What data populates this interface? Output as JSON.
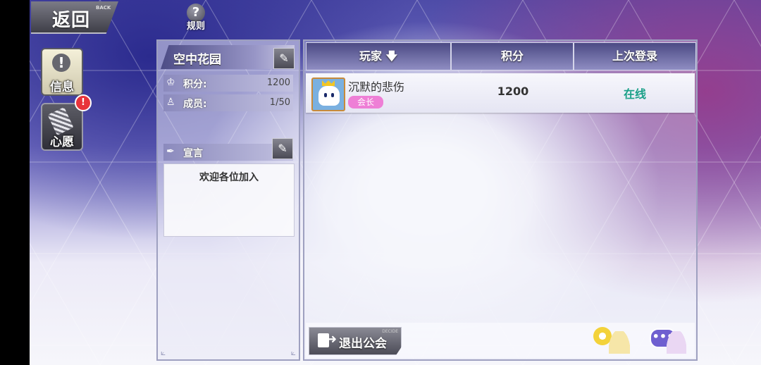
{
  "header": {
    "back_label": "返回",
    "back_sub": "BACK",
    "help_icon": "question-mark-icon",
    "help_label": "规则"
  },
  "sidebar": {
    "items": [
      {
        "label": "信息",
        "icon": "exclamation-icon"
      },
      {
        "label": "心愿",
        "icon": "wish-card-icon",
        "badge": "!"
      }
    ]
  },
  "guild": {
    "name": "空中花园",
    "score_label": "积分:",
    "score_value": "1200",
    "members_label": "成员:",
    "members_value": "1/50",
    "declaration_label": "宣言",
    "declaration_text": "欢迎各位加入"
  },
  "members_table": {
    "columns": [
      "玩家",
      "积分",
      "上次登录"
    ],
    "sort_indicator": "down-arrow-icon",
    "rows": [
      {
        "name": "沉默的悲伤",
        "role": "会长",
        "score": "1200",
        "status": "在线"
      }
    ]
  },
  "footer": {
    "exit_label": "退出公会",
    "exit_sub": "DECIDE",
    "settings_icon": "gear-person-icon",
    "chat_icon": "chat-person-icon"
  },
  "colors": {
    "online": "#1aa088",
    "role_tag": "#ee7fd6",
    "badge": "#e8343b",
    "header_bar": "#4b4a84"
  }
}
